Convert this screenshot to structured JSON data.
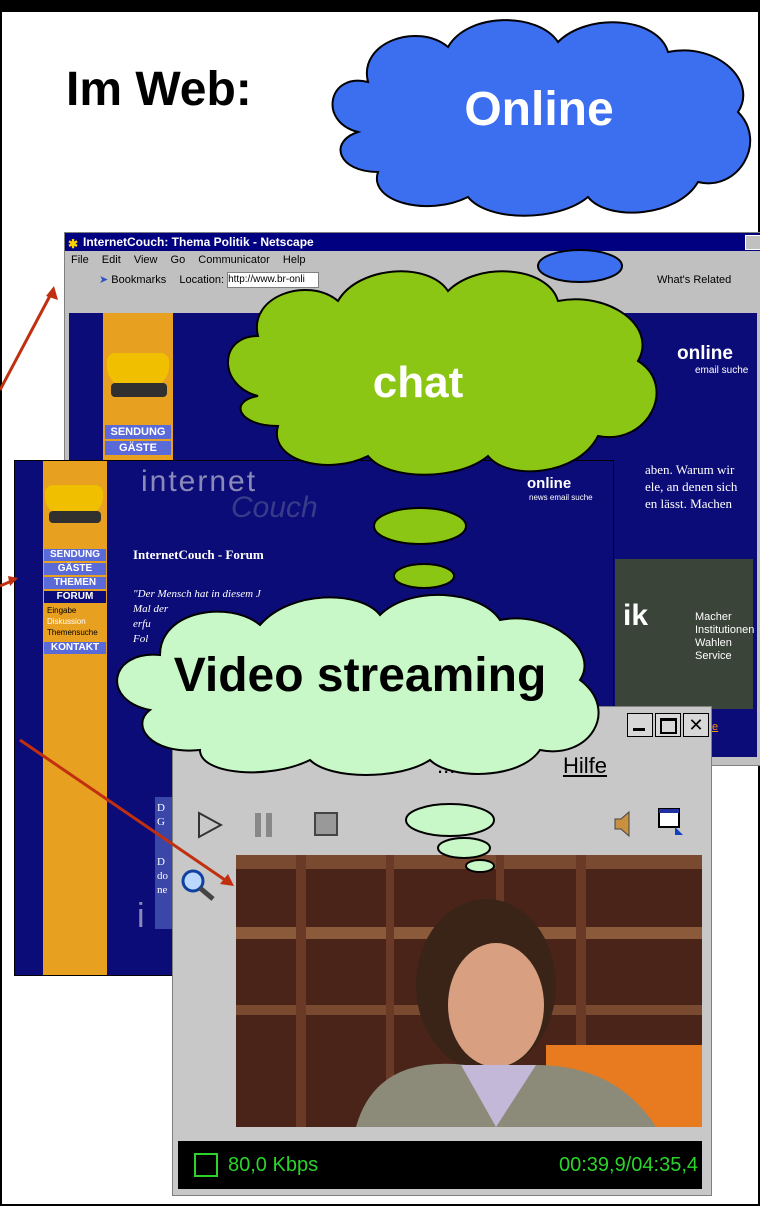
{
  "slide": {
    "title": "Im Web:"
  },
  "clouds": {
    "online": "Online",
    "chat": "chat",
    "video": "Video streaming"
  },
  "browser": {
    "title": "InternetCouch: Thema Politik - Netscape",
    "menu": [
      "File",
      "Edit",
      "View",
      "Go",
      "Communicator",
      "Help"
    ],
    "bookmarks": "Bookmarks",
    "location_label": "Location:",
    "location_value": "http://www.br-onli",
    "whats_related": "What's Related",
    "logo": "online",
    "logo_sub": "email  suche",
    "nav": [
      "SENDUNG",
      "GÄSTE"
    ],
    "body_lines": [
      "aben. Warum wir",
      "ele, an denen sich",
      "en lässt. Machen"
    ],
    "photo_caption": [
      "Macher",
      "Institutionen",
      "Wahlen",
      "Service"
    ],
    "photo_word": "ik",
    "link": "line"
  },
  "forum": {
    "brand": "internet",
    "brand2": "Couch",
    "logo": "online",
    "logo_sub": "news  email  suche",
    "nav": [
      "SENDUNG",
      "GÄSTE",
      "THEMEN",
      "FORUM"
    ],
    "sub": [
      "Eingabe",
      "Diskussion",
      "Themensuche"
    ],
    "contact": "KONTAKT",
    "heading": "InternetCouch - Forum",
    "quote": [
      "\"Der Mensch hat in diesem J",
      "Mal der",
      "erfu",
      "Fol"
    ],
    "items": [
      "D",
      "G",
      "D",
      "do",
      "ne"
    ],
    "icon_letter": "i"
  },
  "player": {
    "menu_hilfe": "Hilfe",
    "menu_left": "...en",
    "bitrate": "80,0 Kbps",
    "time": "00:39,9/04:35,4"
  }
}
